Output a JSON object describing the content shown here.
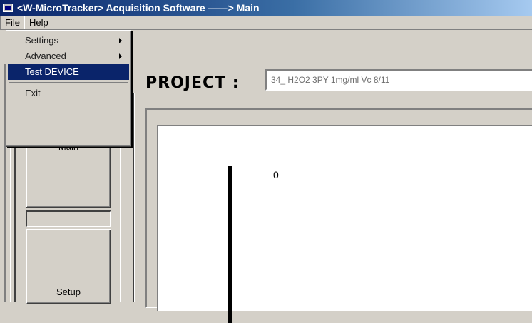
{
  "window": {
    "title": "<W-MicroTracker> Acquisition Software  ——> Main"
  },
  "menubar": {
    "items": [
      {
        "label": "File"
      },
      {
        "label": "Help"
      }
    ]
  },
  "file_menu": {
    "items": [
      {
        "label": "Settings",
        "submenu": true
      },
      {
        "label": "Advanced",
        "submenu": true
      },
      {
        "label": "Test DEVICE",
        "highlighted": true
      },
      {
        "label": "Exit"
      }
    ]
  },
  "project": {
    "label": "PROJECT :",
    "value": "34_ H2O2 3PY 1mg/ml Vc 8/11"
  },
  "nav": {
    "main_label": "Main",
    "setup_label": "Setup"
  },
  "plot": {
    "value_label": "0"
  },
  "colors": {
    "title_start": "#0a246a",
    "title_end": "#a6caf0",
    "highlight": "#0a246a"
  }
}
